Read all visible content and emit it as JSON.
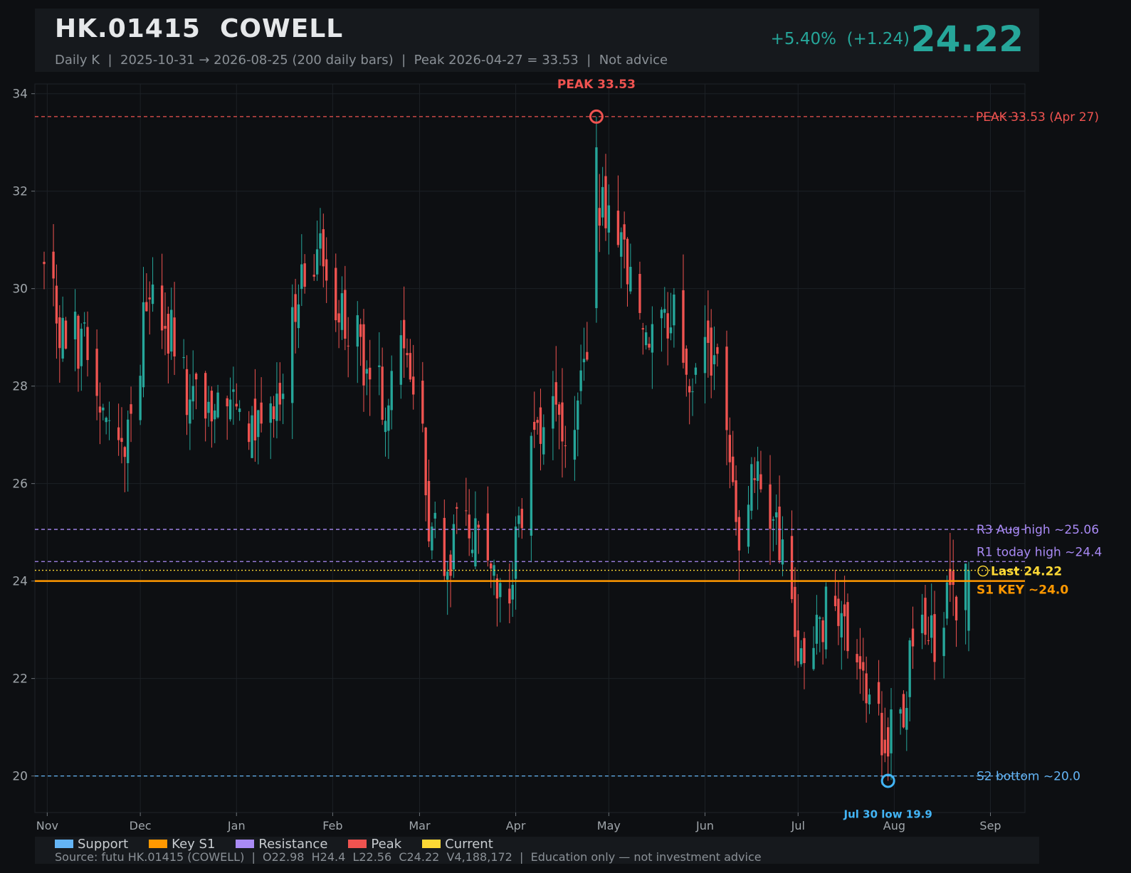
{
  "header": {
    "title": "HK.01415  COWELL",
    "subtitle": "Daily K  |  2025-10-31 → 2026-08-25 (200 daily bars)  |  Peak 2026-04-27 = 33.53  |  Not advice",
    "change": "+5.40%  (+1.24)",
    "price": "24.22"
  },
  "colors": {
    "up": "#26a69a",
    "down": "#ef5350",
    "support": "#64b5f6",
    "key_s1": "#ff9800",
    "resistance": "#a98af5",
    "peak": "#ef5350",
    "current": "#fdd835"
  },
  "chart_data": {
    "type": "candlestick",
    "ylim": [
      19.25,
      34.2
    ],
    "yticks": [
      20,
      22,
      24,
      26,
      28,
      30,
      32,
      34
    ],
    "xticks": [
      {
        "label": "Nov",
        "date": "2025-11-01"
      },
      {
        "label": "Dec",
        "date": "2025-12-01"
      },
      {
        "label": "Jan",
        "date": "2026-01-01"
      },
      {
        "label": "Feb",
        "date": "2026-02-01"
      },
      {
        "label": "Mar",
        "date": "2026-03-01"
      },
      {
        "label": "Apr",
        "date": "2026-04-01"
      },
      {
        "label": "May",
        "date": "2026-05-01"
      },
      {
        "label": "Jun",
        "date": "2026-06-01"
      },
      {
        "label": "Jul",
        "date": "2026-07-01"
      },
      {
        "label": "Aug",
        "date": "2026-08-01"
      },
      {
        "label": "Sep",
        "date": "2026-09-01"
      }
    ],
    "anchors": [
      [
        "2025-10-31",
        31.0
      ],
      [
        "2025-11-05",
        29.4
      ],
      [
        "2025-11-10",
        29.0
      ],
      [
        "2025-11-15",
        28.9
      ],
      [
        "2025-11-20",
        27.2
      ],
      [
        "2025-11-24",
        26.3
      ],
      [
        "2025-11-28",
        27.7
      ],
      [
        "2025-12-05",
        30.2
      ],
      [
        "2025-12-10",
        29.2
      ],
      [
        "2025-12-16",
        28.0
      ],
      [
        "2025-12-22",
        27.5
      ],
      [
        "2025-12-30",
        27.8
      ],
      [
        "2026-01-05",
        26.9
      ],
      [
        "2026-01-12",
        27.8
      ],
      [
        "2026-01-17",
        28.5
      ],
      [
        "2026-01-23",
        30.5
      ],
      [
        "2026-01-28",
        30.8
      ],
      [
        "2026-02-03",
        29.8
      ],
      [
        "2026-02-08",
        29.2
      ],
      [
        "2026-02-13",
        28.3
      ],
      [
        "2026-02-18",
        27.6
      ],
      [
        "2026-02-25",
        28.8
      ],
      [
        "2026-03-01",
        27.4
      ],
      [
        "2026-03-04",
        25.0
      ],
      [
        "2026-03-10",
        24.5
      ],
      [
        "2026-03-16",
        25.2
      ],
      [
        "2026-03-21",
        24.6
      ],
      [
        "2026-03-27",
        23.5
      ],
      [
        "2026-04-01",
        24.5
      ],
      [
        "2026-04-05",
        26.3
      ],
      [
        "2026-04-10",
        27.5
      ],
      [
        "2026-04-15",
        27.1
      ],
      [
        "2026-04-20",
        27.7
      ],
      [
        "2026-04-24",
        29.0
      ],
      [
        "2026-04-27",
        32.0
      ],
      [
        "2026-05-02",
        31.2
      ],
      [
        "2026-05-07",
        30.6
      ],
      [
        "2026-05-12",
        29.6
      ],
      [
        "2026-05-17",
        28.9
      ],
      [
        "2026-05-22",
        29.7
      ],
      [
        "2026-05-27",
        28.3
      ],
      [
        "2026-06-02",
        28.9
      ],
      [
        "2026-06-07",
        27.8
      ],
      [
        "2026-06-12",
        25.2
      ],
      [
        "2026-06-17",
        26.5
      ],
      [
        "2026-06-22",
        25.5
      ],
      [
        "2026-06-27",
        24.3
      ],
      [
        "2026-07-02",
        22.2
      ],
      [
        "2026-07-07",
        23.1
      ],
      [
        "2026-07-12",
        23.5
      ],
      [
        "2026-07-17",
        22.6
      ],
      [
        "2026-07-22",
        21.7
      ],
      [
        "2026-07-27",
        20.9
      ],
      [
        "2026-07-30",
        20.6
      ],
      [
        "2026-08-04",
        21.4
      ],
      [
        "2026-08-08",
        23.0
      ],
      [
        "2026-08-13",
        22.7
      ],
      [
        "2026-08-18",
        23.6
      ],
      [
        "2026-08-22",
        23.3
      ],
      [
        "2026-08-25",
        24.22
      ]
    ],
    "last_bar": {
      "open": 22.98,
      "high": 24.4,
      "low": 22.56,
      "close": 24.22,
      "date": "2026-08-25"
    },
    "levels": [
      {
        "value": 33.53,
        "kind": "peak",
        "style": "dashed",
        "label": "PEAK 33.53 (Apr 27)"
      },
      {
        "value": 25.06,
        "kind": "resistance",
        "style": "dashed",
        "label": "R3 Aug high ~25.06"
      },
      {
        "value": 24.4,
        "kind": "resistance",
        "style": "dashed",
        "label": "R1 today high ~24.4"
      },
      {
        "value": 24.22,
        "kind": "current",
        "style": "dotted",
        "label": "Last 24.22"
      },
      {
        "value": 24.0,
        "kind": "key_s1",
        "style": "solid",
        "label": "S1 KEY ~24.0"
      },
      {
        "value": 20.0,
        "kind": "support",
        "style": "dashed",
        "label": "S2 bottom ~20.0"
      }
    ],
    "peak_marker": {
      "date": "2026-04-27",
      "value": 33.53,
      "label": "PEAK 33.53"
    },
    "low_marker": {
      "date": "2026-07-30",
      "value": 19.9,
      "label": "Jul 30 low 19.9"
    }
  },
  "legend": [
    {
      "label": "Support",
      "color": "#64b5f6"
    },
    {
      "label": "Key S1",
      "color": "#ff9800"
    },
    {
      "label": "Resistance",
      "color": "#a98af5"
    },
    {
      "label": "Peak",
      "color": "#ef5350"
    },
    {
      "label": "Current",
      "color": "#fdd835"
    }
  ],
  "footer": {
    "source": "Source: futu HK.01415 (COWELL)  |  O22.98  H24.4  L22.56  C24.22  V4,188,172  |  Education only — not investment advice"
  }
}
